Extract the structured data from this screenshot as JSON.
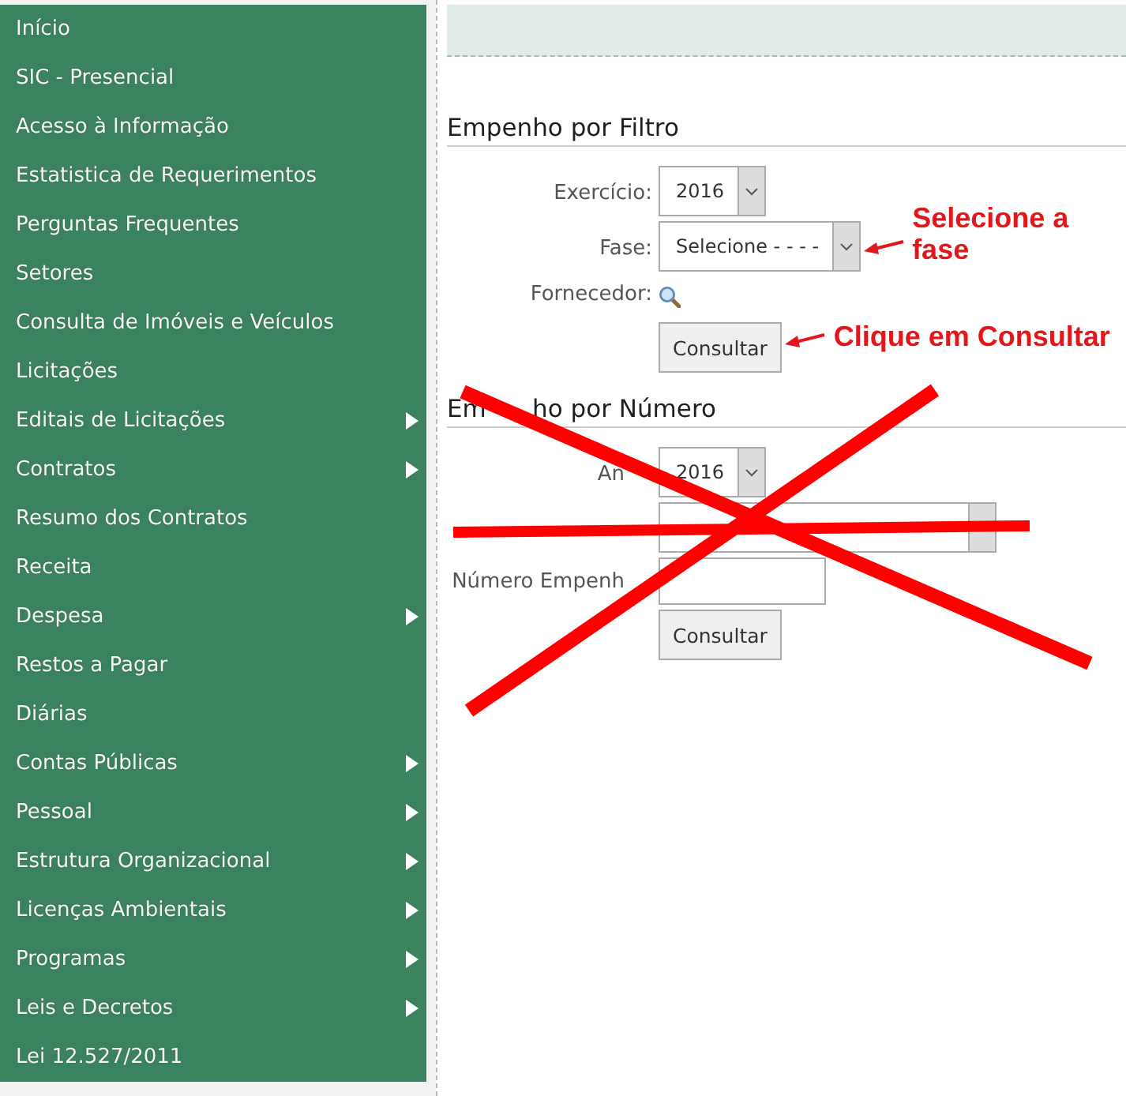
{
  "sidebar": {
    "items": [
      {
        "label": "Início",
        "submenu": false
      },
      {
        "label": "SIC - Presencial",
        "submenu": false
      },
      {
        "label": "Acesso à Informação",
        "submenu": false
      },
      {
        "label": "Estatistica de Requerimentos",
        "submenu": false
      },
      {
        "label": "Perguntas Frequentes",
        "submenu": false
      },
      {
        "label": "Setores",
        "submenu": false
      },
      {
        "label": "Consulta de Imóveis e Veículos",
        "submenu": false
      },
      {
        "label": "Licitações",
        "submenu": false
      },
      {
        "label": "Editais de Licitações",
        "submenu": true
      },
      {
        "label": "Contratos",
        "submenu": true
      },
      {
        "label": "Resumo dos Contratos",
        "submenu": false
      },
      {
        "label": "Receita",
        "submenu": false
      },
      {
        "label": "Despesa",
        "submenu": true
      },
      {
        "label": "Restos a Pagar",
        "submenu": false
      },
      {
        "label": "Diárias",
        "submenu": false
      },
      {
        "label": "Contas Públicas",
        "submenu": true
      },
      {
        "label": "Pessoal",
        "submenu": true
      },
      {
        "label": "Estrutura Organizacional",
        "submenu": true
      },
      {
        "label": "Licenças Ambientais",
        "submenu": true
      },
      {
        "label": "Programas",
        "submenu": true
      },
      {
        "label": "Leis e Decretos",
        "submenu": true
      },
      {
        "label": "Lei 12.527/2011",
        "submenu": false
      }
    ]
  },
  "sections": [
    {
      "title_parts": [
        "Empenho por Filtro"
      ],
      "crossed_out": false,
      "fields": [
        {
          "kind": "select",
          "label": "Exercício:",
          "value": "2016"
        },
        {
          "kind": "select",
          "label": "Fase:",
          "value": "Selecione - - - -",
          "callout": "Selecione a fase"
        },
        {
          "kind": "lookup",
          "label": "Fornecedor:"
        }
      ],
      "button": {
        "label": "Consultar",
        "callout": "Clique em Consultar"
      }
    },
    {
      "title_parts": [
        "Em",
        "ho por Número"
      ],
      "crossed_out": true,
      "fields": [
        {
          "kind": "select",
          "label": "An",
          "value": "2016"
        },
        {
          "kind": "select"
        },
        {
          "kind": "text",
          "label": "Número Empenh"
        }
      ],
      "button": {
        "label": "Consultar"
      }
    }
  ]
}
